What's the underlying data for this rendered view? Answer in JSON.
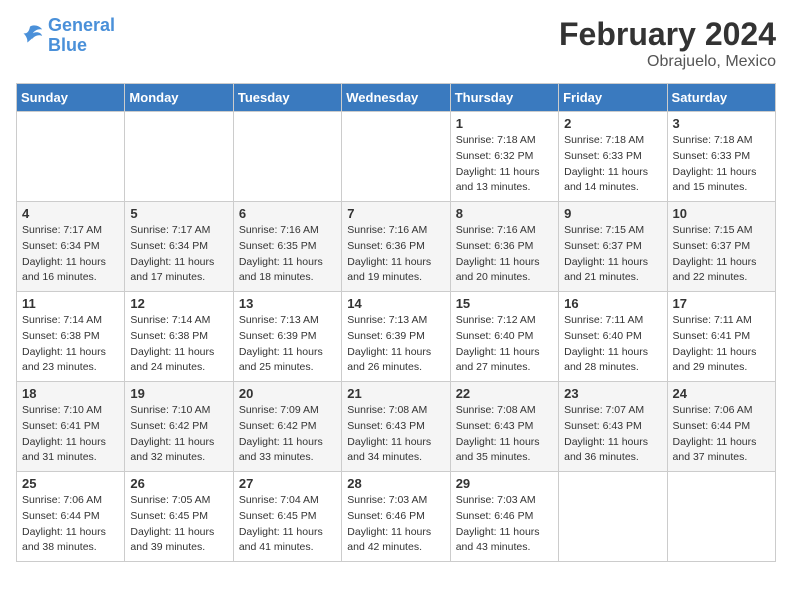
{
  "header": {
    "logo_line1": "General",
    "logo_line2": "Blue",
    "title": "February 2024",
    "subtitle": "Obrajuelo, Mexico"
  },
  "weekdays": [
    "Sunday",
    "Monday",
    "Tuesday",
    "Wednesday",
    "Thursday",
    "Friday",
    "Saturday"
  ],
  "weeks": [
    [
      {
        "day": "",
        "info": ""
      },
      {
        "day": "",
        "info": ""
      },
      {
        "day": "",
        "info": ""
      },
      {
        "day": "",
        "info": ""
      },
      {
        "day": "1",
        "info": "Sunrise: 7:18 AM\nSunset: 6:32 PM\nDaylight: 11 hours\nand 13 minutes."
      },
      {
        "day": "2",
        "info": "Sunrise: 7:18 AM\nSunset: 6:33 PM\nDaylight: 11 hours\nand 14 minutes."
      },
      {
        "day": "3",
        "info": "Sunrise: 7:18 AM\nSunset: 6:33 PM\nDaylight: 11 hours\nand 15 minutes."
      }
    ],
    [
      {
        "day": "4",
        "info": "Sunrise: 7:17 AM\nSunset: 6:34 PM\nDaylight: 11 hours\nand 16 minutes."
      },
      {
        "day": "5",
        "info": "Sunrise: 7:17 AM\nSunset: 6:34 PM\nDaylight: 11 hours\nand 17 minutes."
      },
      {
        "day": "6",
        "info": "Sunrise: 7:16 AM\nSunset: 6:35 PM\nDaylight: 11 hours\nand 18 minutes."
      },
      {
        "day": "7",
        "info": "Sunrise: 7:16 AM\nSunset: 6:36 PM\nDaylight: 11 hours\nand 19 minutes."
      },
      {
        "day": "8",
        "info": "Sunrise: 7:16 AM\nSunset: 6:36 PM\nDaylight: 11 hours\nand 20 minutes."
      },
      {
        "day": "9",
        "info": "Sunrise: 7:15 AM\nSunset: 6:37 PM\nDaylight: 11 hours\nand 21 minutes."
      },
      {
        "day": "10",
        "info": "Sunrise: 7:15 AM\nSunset: 6:37 PM\nDaylight: 11 hours\nand 22 minutes."
      }
    ],
    [
      {
        "day": "11",
        "info": "Sunrise: 7:14 AM\nSunset: 6:38 PM\nDaylight: 11 hours\nand 23 minutes."
      },
      {
        "day": "12",
        "info": "Sunrise: 7:14 AM\nSunset: 6:38 PM\nDaylight: 11 hours\nand 24 minutes."
      },
      {
        "day": "13",
        "info": "Sunrise: 7:13 AM\nSunset: 6:39 PM\nDaylight: 11 hours\nand 25 minutes."
      },
      {
        "day": "14",
        "info": "Sunrise: 7:13 AM\nSunset: 6:39 PM\nDaylight: 11 hours\nand 26 minutes."
      },
      {
        "day": "15",
        "info": "Sunrise: 7:12 AM\nSunset: 6:40 PM\nDaylight: 11 hours\nand 27 minutes."
      },
      {
        "day": "16",
        "info": "Sunrise: 7:11 AM\nSunset: 6:40 PM\nDaylight: 11 hours\nand 28 minutes."
      },
      {
        "day": "17",
        "info": "Sunrise: 7:11 AM\nSunset: 6:41 PM\nDaylight: 11 hours\nand 29 minutes."
      }
    ],
    [
      {
        "day": "18",
        "info": "Sunrise: 7:10 AM\nSunset: 6:41 PM\nDaylight: 11 hours\nand 31 minutes."
      },
      {
        "day": "19",
        "info": "Sunrise: 7:10 AM\nSunset: 6:42 PM\nDaylight: 11 hours\nand 32 minutes."
      },
      {
        "day": "20",
        "info": "Sunrise: 7:09 AM\nSunset: 6:42 PM\nDaylight: 11 hours\nand 33 minutes."
      },
      {
        "day": "21",
        "info": "Sunrise: 7:08 AM\nSunset: 6:43 PM\nDaylight: 11 hours\nand 34 minutes."
      },
      {
        "day": "22",
        "info": "Sunrise: 7:08 AM\nSunset: 6:43 PM\nDaylight: 11 hours\nand 35 minutes."
      },
      {
        "day": "23",
        "info": "Sunrise: 7:07 AM\nSunset: 6:43 PM\nDaylight: 11 hours\nand 36 minutes."
      },
      {
        "day": "24",
        "info": "Sunrise: 7:06 AM\nSunset: 6:44 PM\nDaylight: 11 hours\nand 37 minutes."
      }
    ],
    [
      {
        "day": "25",
        "info": "Sunrise: 7:06 AM\nSunset: 6:44 PM\nDaylight: 11 hours\nand 38 minutes."
      },
      {
        "day": "26",
        "info": "Sunrise: 7:05 AM\nSunset: 6:45 PM\nDaylight: 11 hours\nand 39 minutes."
      },
      {
        "day": "27",
        "info": "Sunrise: 7:04 AM\nSunset: 6:45 PM\nDaylight: 11 hours\nand 41 minutes."
      },
      {
        "day": "28",
        "info": "Sunrise: 7:03 AM\nSunset: 6:46 PM\nDaylight: 11 hours\nand 42 minutes."
      },
      {
        "day": "29",
        "info": "Sunrise: 7:03 AM\nSunset: 6:46 PM\nDaylight: 11 hours\nand 43 minutes."
      },
      {
        "day": "",
        "info": ""
      },
      {
        "day": "",
        "info": ""
      }
    ]
  ]
}
